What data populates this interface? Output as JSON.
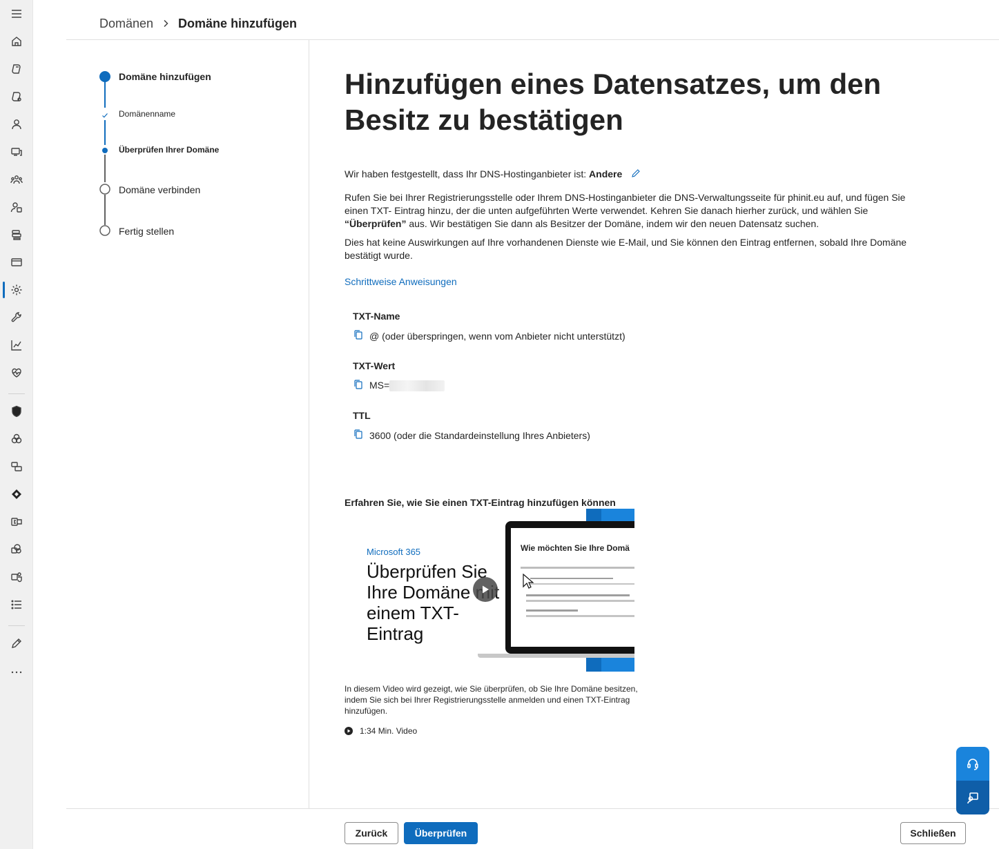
{
  "breadcrumb": {
    "parent": "Domänen",
    "current": "Domäne hinzufügen"
  },
  "steps": [
    {
      "label": "Domäne hinzufügen",
      "state": "active-main"
    },
    {
      "label": "Domänenname",
      "state": "done-sub"
    },
    {
      "label": "Überprüfen Ihrer Domäne",
      "state": "active-sub"
    },
    {
      "label": "Domäne verbinden",
      "state": "pending"
    },
    {
      "label": "Fertig stellen",
      "state": "pending"
    }
  ],
  "main": {
    "title": "Hinzufügen eines Datensatzes, um den Besitz zu bestätigen",
    "detected_prefix": "Wir haben festgestellt, dass Ihr DNS-Hostinganbieter ist: ",
    "detected_provider": "Andere",
    "para1_a": "Rufen Sie bei Ihrer Registrierungsstelle oder Ihrem DNS-Hostinganbieter die DNS-Verwaltungsseite für phinit.eu auf, und fügen Sie einen TXT- Eintrag hinzu, der die unten aufgeführten Werte verwendet. Kehren Sie danach hierher zurück, und wählen Sie ",
    "para1_bold": "“Überprüfen”",
    "para1_b": " aus. Wir bestätigen Sie dann als Besitzer der Domäne, indem wir den neuen Datensatz suchen.",
    "para2": "Dies hat keine Auswirkungen auf Ihre vorhandenen Dienste wie E-Mail, und Sie können den Eintrag entfernen, sobald Ihre Domäne bestätigt wurde.",
    "instructions_link": "Schrittweise Anweisungen"
  },
  "record": {
    "name_label": "TXT-Name",
    "name_value": "@ (oder überspringen, wenn vom Anbieter nicht unterstützt)",
    "value_label": "TXT-Wert",
    "value_prefix": "MS=",
    "ttl_label": "TTL",
    "ttl_value": "3600 (oder die Standardeinstellung Ihres Anbieters)"
  },
  "video": {
    "heading": "Erfahren Sie, wie Sie einen TXT-Eintrag hinzufügen können",
    "brand": "Microsoft 365",
    "headline": "Überprüfen Sie Ihre Domäne mit einem TXT-Eintrag",
    "screen_title": "Wie möchten Sie Ihre Domä",
    "description": "In diesem Video wird gezeigt, wie Sie überprüfen, ob Sie Ihre Domäne besitzen, indem Sie sich bei Ihrer Registrierungsstelle anmelden und einen TXT-Eintrag hinzufügen.",
    "duration": "1:34 Min. Video"
  },
  "footer": {
    "back_label": "Zurück",
    "verify_label": "Überprüfen",
    "close_label": "Schließen"
  },
  "colors": {
    "accent": "#0f6cbd",
    "text": "#242424",
    "rail_bg": "#f0f0f0"
  },
  "rail_icons": [
    "menu-icon",
    "home-icon",
    "copilot-icon",
    "copilot-settings-icon",
    "users-icon",
    "devices-icon",
    "teams-groups-icon",
    "roles-icon",
    "resources-icon",
    "billing-icon",
    "settings-icon",
    "setup-icon",
    "reports-icon",
    "health-icon",
    "security-icon",
    "compliance-icon",
    "endpoint-icon",
    "azure-ad-icon",
    "exchange-icon",
    "sharepoint-icon",
    "teams-icon",
    "all-admin-centers-icon",
    "customize-icon",
    "more-icon"
  ]
}
